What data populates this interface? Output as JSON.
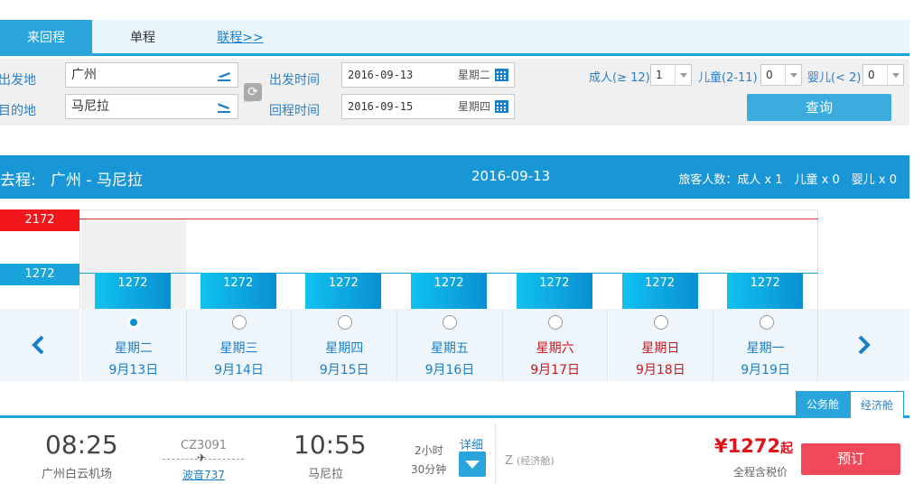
{
  "tabs": {
    "round_trip": "来回程",
    "one_way": "单程",
    "multi_city": "联程>>"
  },
  "search": {
    "origin_label": "出发地",
    "origin_value": "广州",
    "dest_label": "目的地",
    "dest_value": "马尼拉",
    "depart_label": "出发时间",
    "depart_date": "2016-09-13",
    "depart_weekday": "星期二",
    "return_label": "回程时间",
    "return_date": "2016-09-15",
    "return_weekday": "星期四",
    "adult_label": "成人(≥ 12)",
    "adult_value": "1",
    "child_label": "儿童(2-11)",
    "child_value": "0",
    "infant_label": "婴儿(< 2)",
    "infant_value": "0",
    "query_button": "查询"
  },
  "route": {
    "label": "去程:",
    "cities": "广州 - 马尼拉",
    "date": "2016-09-13",
    "passengers": "旅客人数：成人 x 1　儿童 x 0　婴儿 x 0"
  },
  "chart_data": {
    "type": "bar",
    "max_label": "2172",
    "min_label": "1272",
    "days": [
      {
        "weekday": "星期二",
        "date": "9月13日",
        "price": "1272",
        "weekend": false,
        "selected": true
      },
      {
        "weekday": "星期三",
        "date": "9月14日",
        "price": "1272",
        "weekend": false,
        "selected": false
      },
      {
        "weekday": "星期四",
        "date": "9月15日",
        "price": "1272",
        "weekend": false,
        "selected": false
      },
      {
        "weekday": "星期五",
        "date": "9月16日",
        "price": "1272",
        "weekend": false,
        "selected": false
      },
      {
        "weekday": "星期六",
        "date": "9月17日",
        "price": "1272",
        "weekend": true,
        "selected": false
      },
      {
        "weekday": "星期日",
        "date": "9月18日",
        "price": "1272",
        "weekend": true,
        "selected": false
      },
      {
        "weekday": "星期一",
        "date": "9月19日",
        "price": "1272",
        "weekend": false,
        "selected": false
      }
    ]
  },
  "cabins": {
    "business": "公务舱",
    "economy": "经济舱"
  },
  "flight": {
    "dep_time": "08:25",
    "dep_airport": "广州白云机场",
    "flight_no": "CZ3091",
    "plane_glyph": "✈",
    "aircraft": "波音737",
    "arr_time": "10:55",
    "arr_airport": "马尼拉",
    "duration_h": "2小时",
    "duration_m": "30分钟",
    "detail_label": "详细",
    "cabin_code": "Z",
    "cabin_name": "(经济舱)",
    "price": "¥1272",
    "price_suffix": "起",
    "price_note": "全程含税价",
    "book_button": "预订"
  },
  "colors": {
    "accent": "#1aa3dd",
    "header": "#1996d5",
    "max_price": "#f0161b",
    "price_text": "#e0151b",
    "book": "#f04a5a",
    "weekend": "#c9171c"
  }
}
